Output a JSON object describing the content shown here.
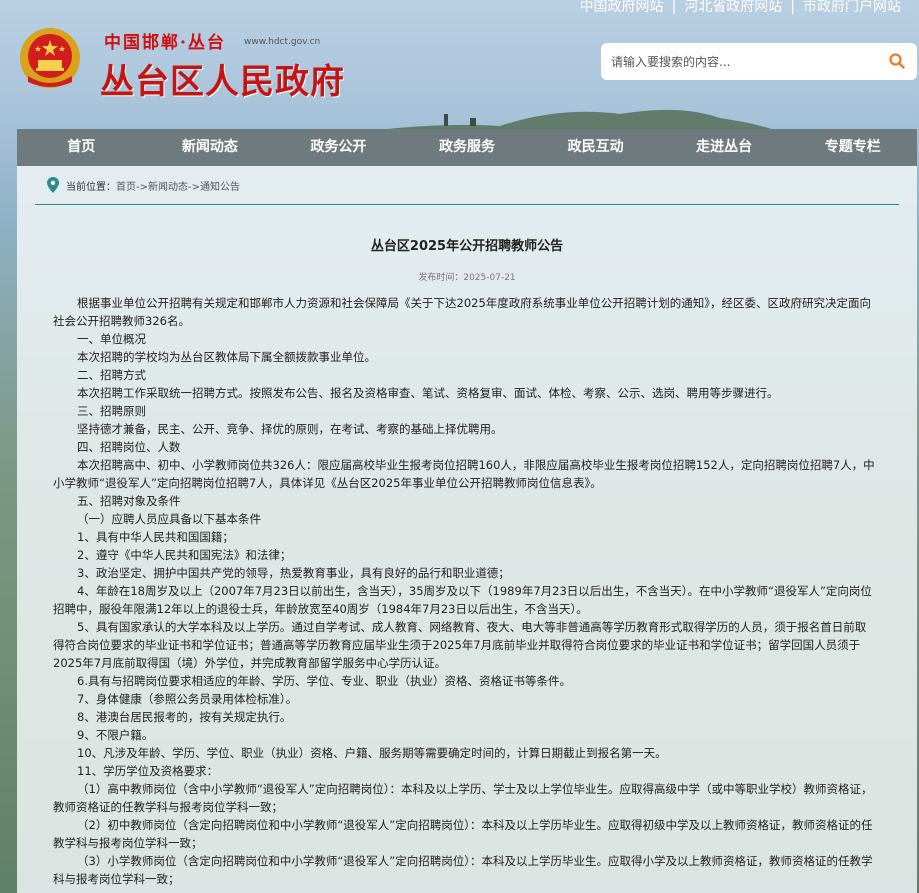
{
  "header": {
    "top_links": [
      "中国政府网站",
      "河北省政府网站",
      "市政府门户网站"
    ],
    "brand_small": "中国邯郸·丛台",
    "brand_url": "www.hdct.gov.cn",
    "brand_big": "丛台区人民政府",
    "search_placeholder": "请输入要搜索的内容..."
  },
  "nav": [
    "首页",
    "新闻动态",
    "政务公开",
    "政务服务",
    "政民互动",
    "走进丛台",
    "专题专栏"
  ],
  "breadcrumb": {
    "label": "当前位置：",
    "path": "首页->新闻动态->通知公告"
  },
  "article": {
    "title": "丛台区2025年公开招聘教师公告",
    "date": "发布时间：2025-07-21",
    "paragraphs": [
      "根据事业单位公开招聘有关规定和邯郸市人力资源和社会保障局《关于下达2025年度政府系统事业单位公开招聘计划的通知》，经区委、区政府研究决定面向社会公开招聘教师326名。",
      "一、单位概况",
      "本次招聘的学校均为丛台区教体局下属全额拨款事业单位。",
      "二、招聘方式",
      "本次招聘工作采取统一招聘方式。按照发布公告、报名及资格审查、笔试、资格复审、面试、体检、考察、公示、选岗、聘用等步骤进行。",
      "三、招聘原则",
      "坚持德才兼备，民主、公开、竞争、择优的原则，在考试、考察的基础上择优聘用。",
      "四、招聘岗位、人数",
      "本次招聘高中、初中、小学教师岗位共326人：限应届高校毕业生报考岗位招聘160人，非限应届高校毕业生报考岗位招聘152人，定向招聘岗位招聘7人，中小学教师“退役军人”定向招聘岗位招聘7人，具体详见《丛台区2025年事业单位公开招聘教师岗位信息表》。",
      "五、招聘对象及条件",
      "（一）应聘人员应具备以下基本条件",
      "1、具有中华人民共和国国籍；",
      "2、遵守《中华人民共和国宪法》和法律；",
      "3、政治坚定、拥护中国共产党的领导，热爱教育事业，具有良好的品行和职业道德；",
      "4、年龄在18周岁及以上（2007年7月23日以前出生，含当天），35周岁及以下（1989年7月23日以后出生，不含当天）。在中小学教师“退役军人”定向岗位招聘中，服役年限满12年以上的退役士兵，年龄放宽至40周岁（1984年7月23日以后出生，不含当天）。",
      "5、具有国家承认的大学本科及以上学历。通过自学考试、成人教育、网络教育、夜大、电大等非普通高等学历教育形式取得学历的人员，须于报名首日前取得符合岗位要求的毕业证书和学位证书；普通高等学历教育应届毕业生须于2025年7月底前毕业并取得符合岗位要求的毕业证书和学位证书；留学回国人员须于2025年7月底前取得国（境）外学位，并完成教育部留学服务中心学历认证。",
      "6.具有与招聘岗位要求相适应的年龄、学历、学位、专业、职业（执业）资格、资格证书等条件。",
      "7、身体健康（参照公务员录用体检标准）。",
      "8、港澳台居民报考的，按有关规定执行。",
      "9、不限户籍。",
      "10、凡涉及年龄、学历、学位、职业（执业）资格、户籍、服务期等需要确定时间的，计算日期截止到报名第一天。",
      "11、学历学位及资格要求：",
      "（1）高中教师岗位（含中小学教师“退役军人”定向招聘岗位）：本科及以上学历、学士及以上学位毕业生。应取得高级中学（或中等职业学校）教师资格证，教师资格证的任教学科与报考岗位学科一致；",
      "（2）初中教师岗位（含定向招聘岗位和中小学教师“退役军人”定向招聘岗位）：本科及以上学历毕业生。应取得初级中学及以上教师资格证，教师资格证的任教学科与报考岗位学科一致；",
      "（3）小学教师岗位（含定向招聘岗位和中小学教师“退役军人”定向招聘岗位）：本科及以上学历毕业生。应取得小学及以上教师资格证，教师资格证的任教学科与报考岗位学科一致；"
    ]
  },
  "colors": {
    "nav_bg": "#6f7a7f",
    "brand_red": "#c41414",
    "divider": "#2a8c8c",
    "search_icon": "#f07820"
  }
}
